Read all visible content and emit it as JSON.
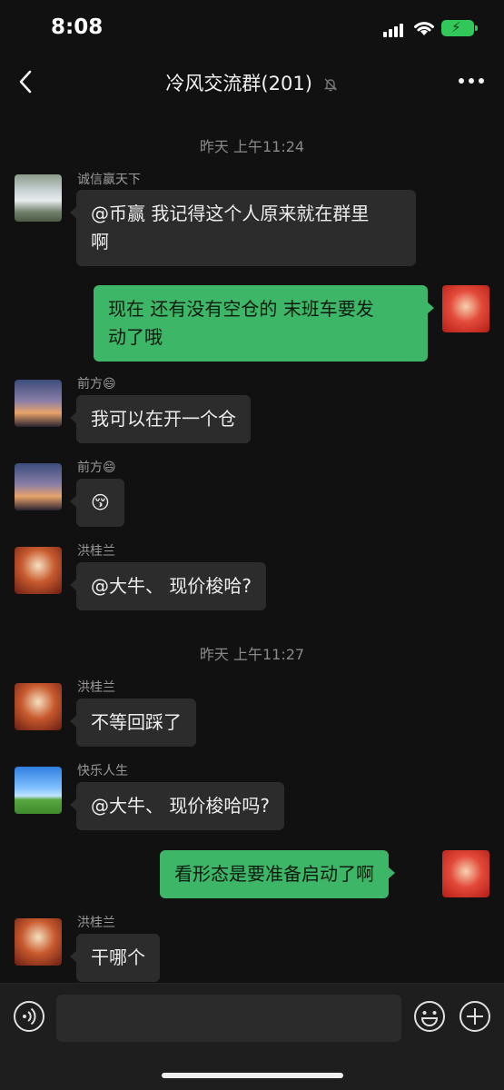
{
  "status_bar": {
    "time": "8:08"
  },
  "header": {
    "title": "冷风交流群(201)"
  },
  "messages": [
    {
      "type": "time",
      "text": "昨天 上午11:24"
    },
    {
      "type": "in",
      "sender": "诚信赢天下",
      "line1": "@币赢 我记得这个人原来就在群里",
      "line2": "啊",
      "avatar": "waterfall"
    },
    {
      "type": "out",
      "line1": "现在 还有没有空仓的   末班车要发",
      "line2": "动了哦",
      "avatar": "red-cartoon"
    },
    {
      "type": "in",
      "sender": "前方😄",
      "text": "我可以在开一个仓",
      "avatar": "sunset"
    },
    {
      "type": "in",
      "sender": "前方😄",
      "text": "😚",
      "avatar": "sunset"
    },
    {
      "type": "in",
      "sender": "洪桂兰",
      "text": "@大牛、 现价梭哈?",
      "avatar": "bunny"
    },
    {
      "type": "time",
      "text": "昨天 上午11:27"
    },
    {
      "type": "in",
      "sender": "洪桂兰",
      "text": "不等回踩了",
      "avatar": "bunny"
    },
    {
      "type": "in",
      "sender": "快乐人生",
      "text": "@大牛、 现价梭哈吗?",
      "avatar": "field"
    },
    {
      "type": "out",
      "text": "看形态是要准备启动了啊",
      "avatar": "red-cartoon"
    },
    {
      "type": "in",
      "sender": "洪桂兰",
      "text": "干哪个",
      "avatar": "bunny"
    }
  ],
  "input_bar": {
    "placeholder": ""
  },
  "icons": {
    "back": "back-chevron-icon",
    "mute": "bell-slash-icon",
    "more": "more-dots-icon",
    "voice": "voice-icon",
    "emoji": "emoji-icon",
    "plus": "plus-icon"
  },
  "colors": {
    "background": "#111111",
    "bubble_in": "#2c2c2c",
    "bubble_out": "#3eb667",
    "battery": "#32c759"
  }
}
